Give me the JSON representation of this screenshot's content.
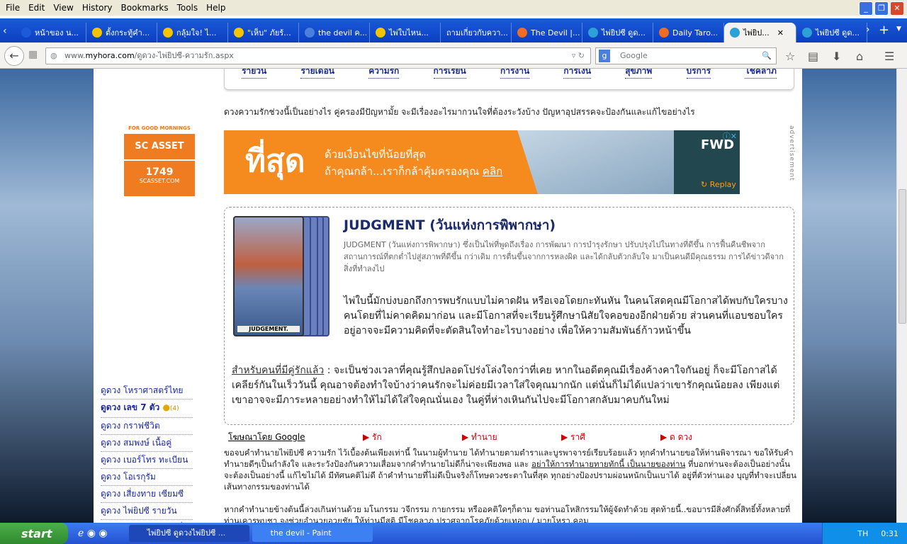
{
  "menubar": [
    "File",
    "Edit",
    "View",
    "History",
    "Bookmarks",
    "Tools",
    "Help"
  ],
  "tabs": [
    {
      "label": "หน้าของ น...",
      "color": "#1b5ad8"
    },
    {
      "label": "ตั้งกระทู้คำ...",
      "color": "#f5c400"
    },
    {
      "label": "กลุ้มใจ! ไ...",
      "color": "#f5c400"
    },
    {
      "label": "\"เห็บ\" ภัยร้...",
      "color": "#f5c400"
    },
    {
      "label": "the devil ค...",
      "color": "#4a7fe0"
    },
    {
      "label": "ไพ่ใบไหน...",
      "color": "#f5c400"
    },
    {
      "label": "ถามเกี่ยวกับควา...",
      "color": ""
    },
    {
      "label": "The Devil |...",
      "color": "#f26b22"
    },
    {
      "label": "ไพ่ยิปซี ดูด...",
      "color": "#2ea0d8"
    },
    {
      "label": "Daily Taro...",
      "color": "#f26b22"
    },
    {
      "label": "ไพ่ยิป...",
      "color": "#2ea0d8",
      "active": true
    },
    {
      "label": "ไพ่ยิปซี ดูด...",
      "color": "#2ea0d8"
    }
  ],
  "url": {
    "prefix": "www.",
    "domain": "myhora.com",
    "path": "/ดูดวง-ไพ่ยิปซี-ความรัก.aspx"
  },
  "search_placeholder": "Google",
  "topnav": [
    "รายวัน",
    "รายเดือน",
    "ความรัก",
    "การเรียน",
    "การงาน",
    "การเงิน",
    "สุขภาพ",
    "บริการ",
    "โชคลาภ"
  ],
  "intro": "ดวงความรักช่วงนี้เป็นอย่างไร คู่ครองมีปัญหามั้ย จะมีเรื่องอะไรมากวนใจที่ต้องระวังบ้าง ปัญหาอุปสรรคจะป้องกันและแก้ไขอย่างไร",
  "banner": {
    "big": "ที่สุด",
    "line1": "ด้วยเงื่อนไขที่น้อยที่สุด",
    "line2": "ถ้าคุณกล้า...เราก็กล้าคุ้มครองคุณ ",
    "cta": "คลิก",
    "brand": "FWD",
    "replay": "Replay",
    "label": "advertisement"
  },
  "leftad": {
    "tag": "FOR GOOD MORNINGS",
    "brand": "SC ASSET",
    "phone": "1749",
    "site": "SCASSET.COM"
  },
  "card": {
    "image_label": "JUDGEMENT.",
    "title": "JUDGMENT (วันแห่งการพิพากษา)",
    "desc": "JUDGMENT (วันแห่งการพิพากษา) ซึ่งเป็นไพ่ที่พูดถึงเรื่อง การพัฒนา การบำรุงรักษา ปรับปรุงไปในทางที่ดีขึ้น การฟื้นคืนชีพจากสถานการณ์ที่ตกต่ำไปสู่สภาพที่ดีขึ้น กว่าเดิม การตื่นขึ้นจากการหลงผิด และได้กลับตัวกลับใจ มาเป็นคนดีมีคุณธรรม การได้ข่าวดีจากสิ่งที่ทำลงไป",
    "p1": "ไพ่ใบนี้มักบ่งบอกถึงการพบรักแบบไม่คาดฝัน หรือเจอโดยกะทันหัน ในคนโสดคุณมีโอกาสได้พบกับใครบางคนโดยที่ไม่คาดคิดมาก่อน และมีโอกาสที่จะเรียนรู้ศึกษานิสัยใจคอของอีกฝ่ายด้วย ส่วนคนที่แอบชอบใครอยู่อาจจะมีความคิดที่จะตัดสินใจทำอะไรบางอย่าง เพื่อให้ความสัมพันธ์ก้าวหน้าขึ้น",
    "p2_label": "สำหรับคนที่มีคู่รักแล้ว",
    "p2": " : จะเป็นช่วงเวลาที่คุณรู้สึกปลอดโปร่งโล่งใจกว่าที่เคย หากในอดีตคุณมีเรื่องค้างคาใจกันอยู่ ก็จะมีโอกาสได้เคลียร์กันในเร็ววันนี้ คุณอาจต้องทำใจบ้างว่าคนรักจะไม่ค่อยมีเวลาใส่ใจคุณมากนัก แต่นั่นก็ไม่ได้แปลว่าเขารักคุณน้อยลง เพียงแต่เขาอาจจะมีภาระหลายอย่างทำให้ไม่ได้ใส่ใจคุณนั่นเอง ในคู่ที่ห่างเหินกันไปจะมีโอกาสกลับมาคบกันใหม่"
  },
  "adlinks": {
    "google": "โฆษณาโดย Google",
    "items": [
      "▶ รัก",
      "▶ ทำนาย",
      "▶ ราศี",
      "▶ ด ดวง"
    ]
  },
  "p3a": "ขอจบคำทำนายไพ่ยิปซี ความรัก ไว้เบื้องต้นเพียงเท่านี้ ในนามผู้ทำนาย ได้ทำนายตามตำราและบูรพาจารย์เรียบร้อยแล้ว ทุกคำทำนายขอให้ท่านพิจารณา ขอให้รับคำทำนายดีๆเป็นกำลังใจ และระวังป้องกันความเสื่อมจากคำทำนายไม่ดีก็น่าจะเพียงพอ และ ",
  "p3u": "อย่าให้การทำนายทายทักนี้ เป็นนายของท่าน",
  "p3b": " ที่บอกท่านจะต้องเป็นอย่างนั้น จะต้องเป็นอย่างนี้ แก้ไขไม่ได้ มีทัศนคติไม่ดี ถ้าคำทำนายที่ไม่ดีเป็นจริงก็โทษดวงชะตาในที่สุด ทุกอย่างป้องปรามผ่อนหนักเป็นเบาได้ อยู่ที่ตัวท่านเอง บุญที่ทำจะเปลี่ยนเส้นทางกรรมของท่านได้",
  "p4": "หากคำทำนายข้างต้นนี้ล่วงเกินท่านด้วย มโนกรรม วจีกรรม กายกรรม หรืออคติใดๆก็ตาม ขอท่านอโหสิกรรมให้ผู้จัดทำด้วย สุดท้ายนี้..ขอบารมีสิ่งศักดิ์สิทธิ์ทั้งหลายที่ท่านเคารพบูชา จงช่วยอำนวยอวยชัย ให้ท่านมีสติ มีโชคลาภ ปราศจากโรคภัยด้วยเทอญ / มายโหรา.คอม",
  "sidelinks": [
    {
      "label": "ดูดวง โหราศาสตร์ไทย"
    },
    {
      "label": "ดูดวง เลข 7 ตัว",
      "bold": true,
      "badge": "(4)"
    },
    {
      "label": "ดูดวง กราฟชีวิต"
    },
    {
      "label": "ดูดวง สมพงษ์ เนื้อคู่"
    },
    {
      "label": "ดูดวง เบอร์โทร ทะเบียน"
    },
    {
      "label": "ดูดวง โอเรกุรัม"
    },
    {
      "label": "ดูดวง เสี่ยงทาย เซียมซี"
    },
    {
      "label": "ดูดวง ไพ่ยิปซี รายวัน"
    },
    {
      "label": "ดูดวง ไพ่ยิปซี เฉพาะเรื่อง"
    }
  ],
  "taskbar": {
    "start": "start",
    "tasks": [
      "ไพ่ยิปซี ดูดวงไพ่ยิปซี ...",
      "the devil - Paint"
    ],
    "lang": "TH",
    "time": "0:31"
  }
}
